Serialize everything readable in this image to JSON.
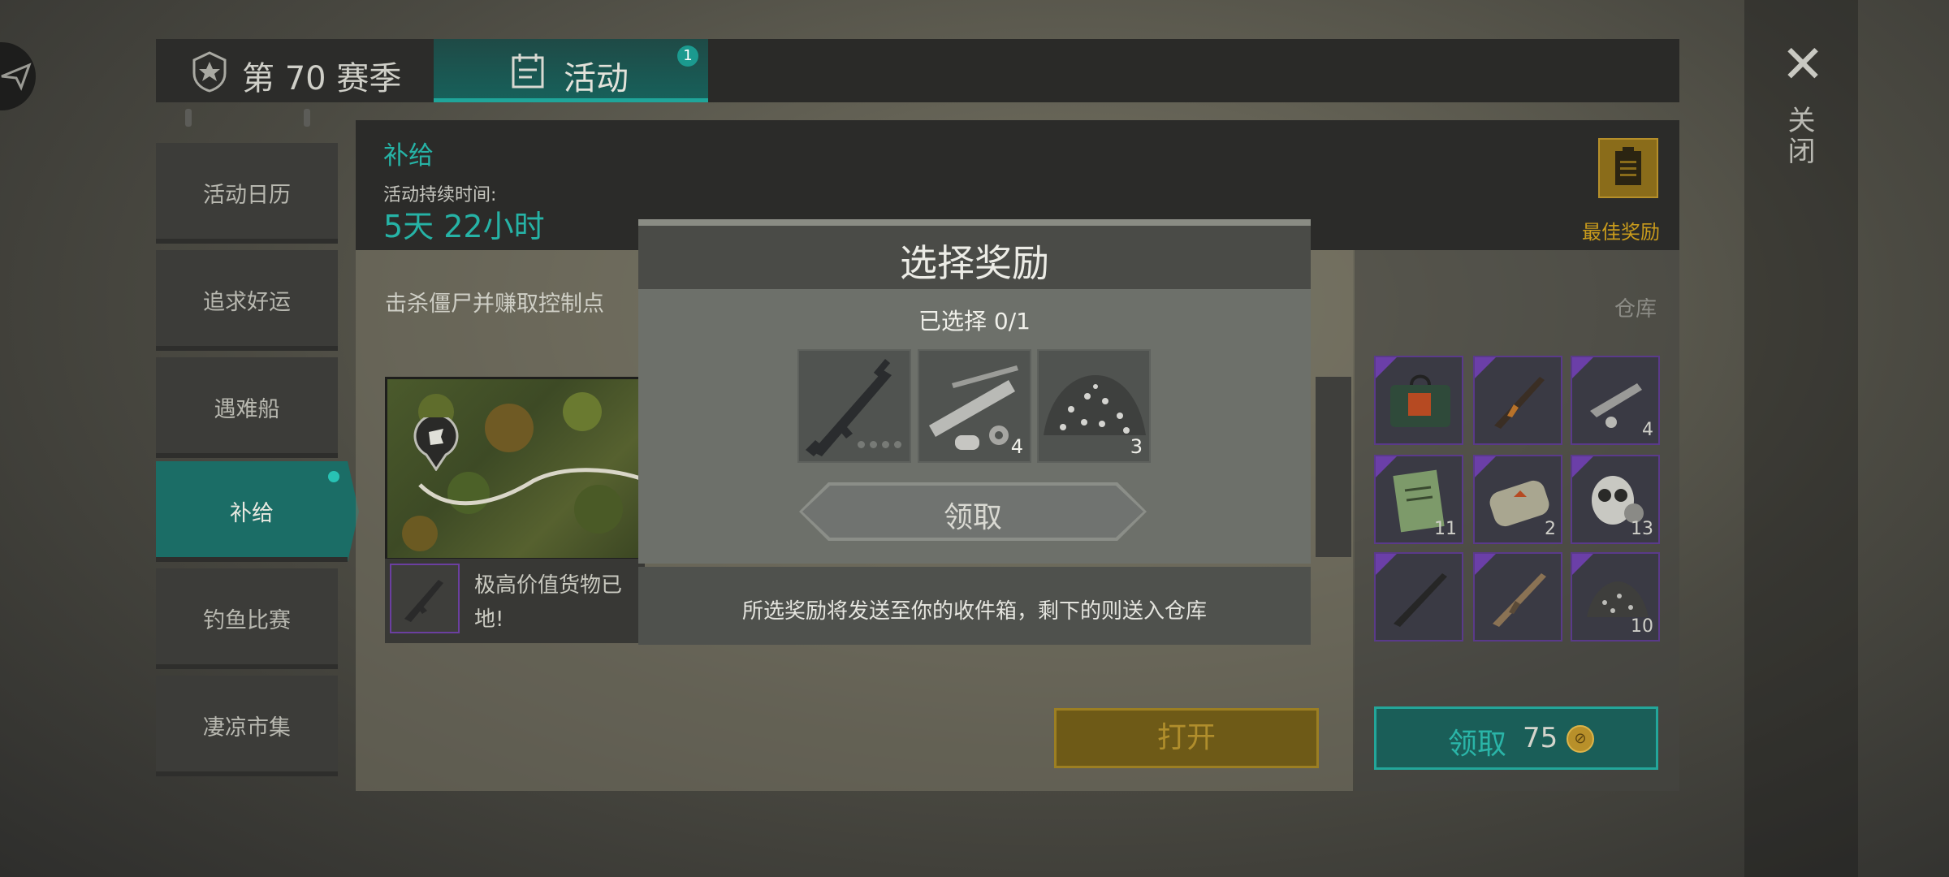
{
  "window": {
    "close_label": "关闭"
  },
  "tabs": [
    {
      "label": "第 70 赛季",
      "icon": "season-shield-icon"
    },
    {
      "label": "活动",
      "icon": "calendar-icon",
      "badge": "1"
    }
  ],
  "sidebar": {
    "items": [
      {
        "label": "活动日历"
      },
      {
        "label": "追求好运"
      },
      {
        "label": "遇难船"
      },
      {
        "label": "补给",
        "active": true
      },
      {
        "label": "钓鱼比赛"
      },
      {
        "label": "凄凉市集"
      }
    ]
  },
  "event": {
    "title": "补给",
    "duration_label": "活动持续时间:",
    "duration_value": "5天 22小时",
    "best_rewards_label": "最佳奖励",
    "task_text": "击杀僵尸并赚取控制点",
    "item_text_line1": "极高价值货物已",
    "item_text_line2": "地!",
    "open_button": "打开"
  },
  "storage": {
    "label": "仓库",
    "slots": [
      {
        "icon": "medkit-bag-icon",
        "qty": ""
      },
      {
        "icon": "ak-rifle-icon",
        "qty": ""
      },
      {
        "icon": "pipe-parts-icon",
        "qty": "4"
      },
      {
        "icon": "notebook-icon",
        "qty": "11"
      },
      {
        "icon": "med-pouch-icon",
        "qty": "2"
      },
      {
        "icon": "gas-mask-icon",
        "qty": "13"
      },
      {
        "icon": "shotgun-icon",
        "qty": ""
      },
      {
        "icon": "tan-rifle-icon",
        "qty": ""
      },
      {
        "icon": "scrap-pile-icon",
        "qty": "10"
      }
    ],
    "claim_label": "领取",
    "claim_cost": "75"
  },
  "modal": {
    "title": "选择奖励",
    "selected": "已选择 0/1",
    "rewards": [
      {
        "icon": "m16-rifle-icon",
        "qty": ""
      },
      {
        "icon": "pipe-parts-icon",
        "qty": "4"
      },
      {
        "icon": "scrap-pile-icon",
        "qty": "3"
      }
    ],
    "claim_button": "领取",
    "note": "所选奖励将发送至你的收件箱，剩下的则送入仓库"
  },
  "colors": {
    "accent": "#26b3a6",
    "gold": "#c99b1c",
    "epic": "#6b3fa8"
  }
}
